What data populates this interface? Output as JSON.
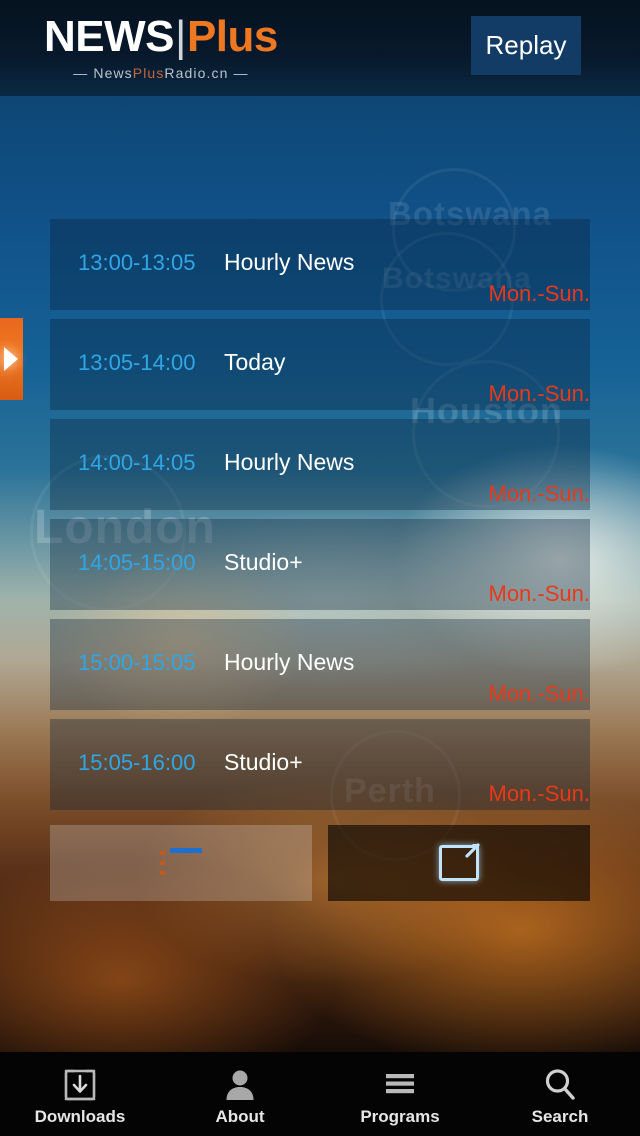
{
  "header": {
    "logo_news": "NEWS",
    "logo_divider": "|",
    "logo_plus": "Plus",
    "tagline_prefix": "— News",
    "tagline_plus": "Plus",
    "tagline_suffix": "Radio.cn —",
    "replay_label": "Replay"
  },
  "side_tab": {
    "name": "expand-arrow",
    "color": "#ee7822"
  },
  "background": {
    "watermarks": [
      "Botswana",
      "Botswana",
      "Houston",
      "London",
      "Perth"
    ]
  },
  "schedule": {
    "rows": [
      {
        "time": "13:00-13:05",
        "title": "Hourly News",
        "days": "Mon.-Sun."
      },
      {
        "time": "13:05-14:00",
        "title": "Today",
        "days": "Mon.-Sun."
      },
      {
        "time": "14:00-14:05",
        "title": "Hourly News",
        "days": "Mon.-Sun."
      },
      {
        "time": "14:05-15:00",
        "title": "Studio+",
        "days": "Mon.-Sun."
      },
      {
        "time": "15:00-15:05",
        "title": "Hourly News",
        "days": "Mon.-Sun."
      },
      {
        "time": "15:05-16:00",
        "title": "Studio+",
        "days": "Mon.-Sun."
      }
    ]
  },
  "actions": {
    "list_icon": "list-icon",
    "share_icon": "share-external-icon"
  },
  "tabbar": {
    "items": [
      {
        "label": "Downloads",
        "icon": "download-icon"
      },
      {
        "label": "About",
        "icon": "person-icon"
      },
      {
        "label": "Programs",
        "icon": "hamburger-icon"
      },
      {
        "label": "Search",
        "icon": "search-icon"
      }
    ]
  },
  "colors": {
    "accent_orange": "#ee7822",
    "time_blue": "#2fa7e6",
    "days_red": "#e8391a",
    "replay_bg": "#123c66"
  }
}
